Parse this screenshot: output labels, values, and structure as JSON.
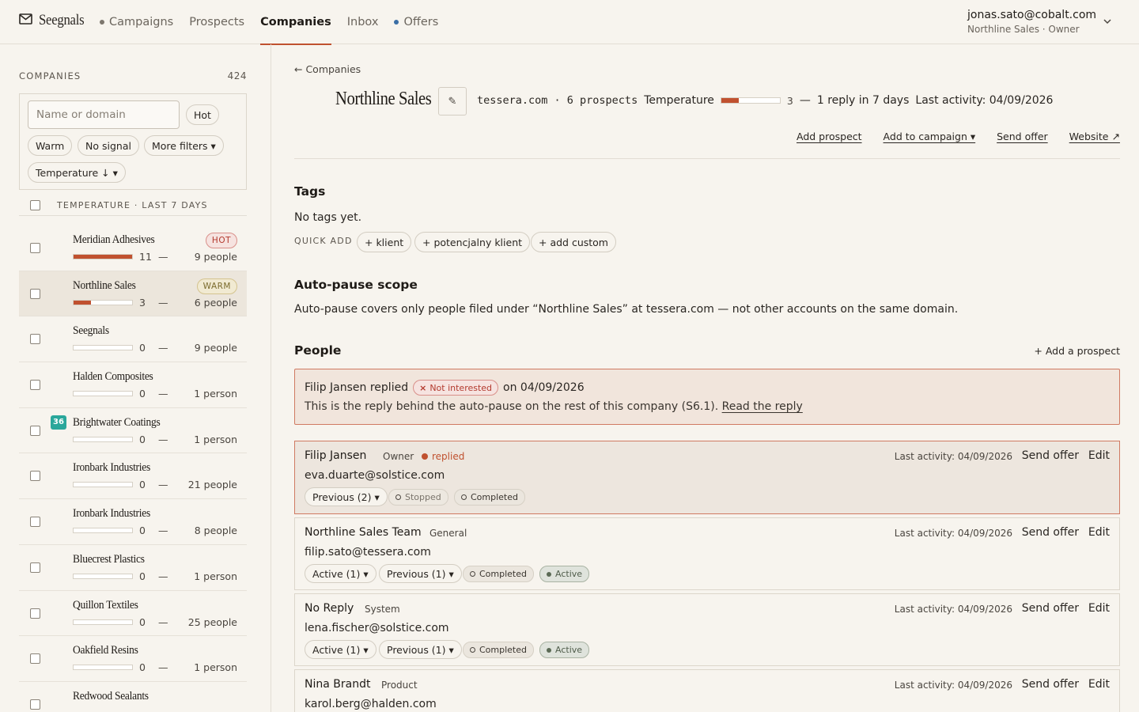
{
  "app": {
    "brand": "Seegnals",
    "nav": [
      {
        "label": "Campaigns",
        "dot": "#7d776e"
      },
      {
        "label": "Prospects"
      },
      {
        "label": "Companies",
        "active": true
      },
      {
        "label": "Inbox"
      },
      {
        "label": "Offers",
        "dot": "#3a6ea5"
      }
    ],
    "account": {
      "email": "jonas.sato@cobalt.com",
      "role": "Northline Sales · Owner"
    }
  },
  "sidebar": {
    "title": "COMPANIES",
    "count": "424",
    "search_placeholder": "Name or domain",
    "chips": [
      "Hot",
      "Warm",
      "No signal",
      "More filters ▾",
      "Temperature ↓ ▾"
    ],
    "list_header": "TEMPERATURE · LAST 7 DAYS",
    "rows": [
      {
        "name": "Meridian Adhesives",
        "badge": "HOT",
        "badge_type": "hot",
        "score": "11",
        "dash": "—",
        "people": "9 people",
        "fill": 1.0
      },
      {
        "name": "Northline Sales",
        "badge": "WARM",
        "badge_type": "warm",
        "score": "3",
        "dash": "—",
        "people": "6 people",
        "fill": 0.3,
        "selected": true
      },
      {
        "name": "Seegnals",
        "score": "0",
        "dash": "—",
        "people": "9 people",
        "fill": 0
      },
      {
        "name": "Halden Composites",
        "score": "0",
        "dash": "—",
        "people": "1 person",
        "fill": 0
      },
      {
        "name": "Brightwater Coatings",
        "score": "0",
        "dash": "—",
        "people": "1 person",
        "fill": 0,
        "num_badge": "36"
      },
      {
        "name": "Ironbark Industries",
        "score": "0",
        "dash": "—",
        "people": "21 people",
        "fill": 0
      },
      {
        "name": "Ironbark Industries",
        "score": "0",
        "dash": "—",
        "people": "8 people",
        "fill": 0
      },
      {
        "name": "Bluecrest Plastics",
        "score": "0",
        "dash": "—",
        "people": "1 person",
        "fill": 0
      },
      {
        "name": "Quillon Textiles",
        "score": "0",
        "dash": "—",
        "people": "25 people",
        "fill": 0
      },
      {
        "name": "Oakfield Resins",
        "score": "0",
        "dash": "—",
        "people": "1 person",
        "fill": 0
      },
      {
        "name": "Redwood Sealants",
        "score": "",
        "dash": "",
        "people": "",
        "fill": 0
      }
    ]
  },
  "main": {
    "breadcrumb": "← Companies",
    "company": "Northline Sales",
    "edit_icon": "✎",
    "domain_info": "tessera.com · 6 prospects",
    "temperature_label": "Temperature",
    "temperature_fill": 0.3,
    "temperature_value": "3",
    "temperature_dash": "—",
    "reply_info": "1 reply in 7 days",
    "last_activity": "Last activity: 04/09/2026",
    "actions": [
      "Add prospect",
      "Add to campaign ▾",
      "Send offer",
      "Website ↗"
    ],
    "tags": {
      "title": "Tags",
      "empty": "No tags yet.",
      "quick_add": "QUICK ADD",
      "chips": [
        "+ klient",
        "+ potencjalny klient",
        "+ add custom"
      ]
    },
    "autopause": {
      "title": "Auto-pause scope",
      "text": "Auto-pause covers only people filed under “Northline Sales” at tessera.com — not other accounts on the same domain."
    },
    "people": {
      "title": "People",
      "add": "+ Add a prospect",
      "notice": {
        "lead": "Filip Jansen replied",
        "pill": "Not interested",
        "date": "on 04/09/2026",
        "text": "This is the reply behind the auto-pause on the rest of this company (S6.1).",
        "link": "Read the reply"
      },
      "cards": [
        {
          "name": "Filip Jansen",
          "role": "Owner",
          "status": "replied",
          "email": "eva.duarte@solstice.com",
          "last": "Last activity: 04/09/2026",
          "send": "Send offer",
          "edit": "Edit",
          "drops": [
            "Previous (2) ▾"
          ],
          "stats": [
            {
              "label": "Stopped",
              "kind": "muted"
            },
            {
              "label": "Completed",
              "kind": "plain"
            }
          ]
        },
        {
          "name": "Northline Sales Team",
          "role": "General",
          "status": "",
          "email": "filip.sato@tessera.com",
          "last": "Last activity: 04/09/2026",
          "send": "Send offer",
          "edit": "Edit",
          "drops": [
            "Active (1) ▾",
            "Previous (1) ▾"
          ],
          "stats": [
            {
              "label": "Completed",
              "kind": "plain"
            },
            {
              "label": "Active",
              "kind": "active"
            }
          ]
        },
        {
          "name": "No Reply",
          "role": "System",
          "status": "",
          "email": "lena.fischer@solstice.com",
          "last": "Last activity: 04/09/2026",
          "send": "Send offer",
          "edit": "Edit",
          "drops": [
            "Active (1) ▾",
            "Previous (1) ▾"
          ],
          "stats": [
            {
              "label": "Completed",
              "kind": "plain"
            },
            {
              "label": "Active",
              "kind": "active"
            }
          ]
        },
        {
          "name": "Nina Brandt",
          "role": "Product",
          "status": "",
          "email": "karol.berg@halden.com",
          "last": "Last activity: 04/09/2026",
          "send": "Send offer",
          "edit": "Edit",
          "drops": [],
          "stats": []
        }
      ]
    }
  },
  "colors": {
    "accent": "#c0512f",
    "background": "#f7f4ee",
    "teal": "#2aa79b"
  }
}
